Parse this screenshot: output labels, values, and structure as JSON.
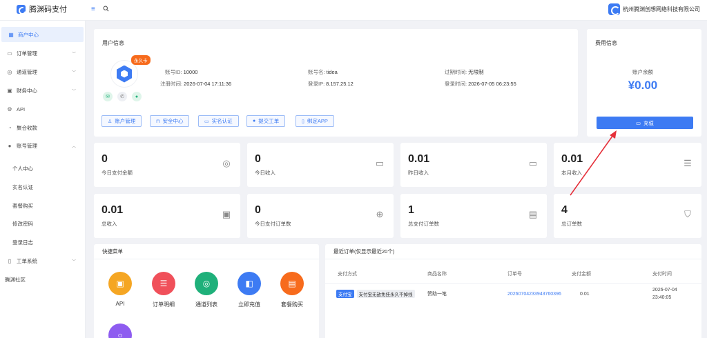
{
  "header": {
    "app_name": "腾渊码支付",
    "company_name": "杭州腾渊创想网络科技有限公司",
    "menu_icon": "menu-icon",
    "search_icon": "search-icon"
  },
  "sidebar": {
    "items": [
      {
        "label": "商户中心",
        "icon": "dashboard-icon",
        "active": true
      },
      {
        "label": "订单管理",
        "icon": "order-icon",
        "expandable": true
      },
      {
        "label": "通道管理",
        "icon": "channel-icon",
        "expandable": true
      },
      {
        "label": "财务中心",
        "icon": "finance-icon",
        "expandable": true
      },
      {
        "label": "API",
        "icon": "api-icon"
      },
      {
        "label": "聚合收款",
        "icon": "aggregate-icon"
      },
      {
        "label": "账号管理",
        "icon": "user-icon",
        "expandable": true,
        "expanded": true
      }
    ],
    "account_sub": [
      "个人中心",
      "实名认证",
      "套餐购买",
      "修改密码",
      "登录日志"
    ],
    "ticket": {
      "label": "工单系统",
      "icon": "ticket-icon"
    },
    "community": "腾渊社区"
  },
  "user_info": {
    "title": "用户信息",
    "badge": "永久卡",
    "account_id_label": "账号ID:",
    "account_id": "10000",
    "register_time_label": "注册时间:",
    "register_time": "2026-07-04 17:11:36",
    "account_name_label": "账号名:",
    "account_name": "tidea",
    "login_ip_label": "登录IP:",
    "login_ip": "8.157.25.12",
    "expire_label": "过期时间:",
    "expire": "无限制",
    "login_time_label": "登录时间:",
    "login_time": "2026-07-05 06:23:55",
    "buttons": [
      "账户管理",
      "安全中心",
      "实名认证",
      "提交工单",
      "绑定APP"
    ]
  },
  "fee_info": {
    "title": "费用信息",
    "balance_label": "账户余额",
    "balance": "¥0.00",
    "recharge_label": "充值"
  },
  "stats": [
    {
      "value": "0",
      "label": "今日支付金额",
      "icon": "gauge-icon"
    },
    {
      "value": "0",
      "label": "今日收入",
      "icon": "folder-icon"
    },
    {
      "value": "0.01",
      "label": "昨日收入",
      "icon": "folder-icon"
    },
    {
      "value": "0.01",
      "label": "本月收入",
      "icon": "database-icon"
    },
    {
      "value": "0.01",
      "label": "总收入",
      "icon": "money-icon"
    },
    {
      "value": "0",
      "label": "今日支付订单数",
      "icon": "target-icon"
    },
    {
      "value": "1",
      "label": "总支付订单数",
      "icon": "card-icon"
    },
    {
      "value": "4",
      "label": "总订单数",
      "icon": "cart-icon"
    }
  ],
  "quick_menu": {
    "title": "快捷菜单",
    "items": [
      {
        "label": "API",
        "color": "#f5a623",
        "icon": "chip-icon"
      },
      {
        "label": "订单明细",
        "color": "#f0505a",
        "icon": "database-icon"
      },
      {
        "label": "通道列表",
        "color": "#1fb07a",
        "icon": "channel-icon"
      },
      {
        "label": "立即充值",
        "color": "#3d7bf3",
        "icon": "wallet-icon"
      },
      {
        "label": "套餐购买",
        "color": "#f76b1c",
        "icon": "clipboard-icon"
      }
    ],
    "extra_item_color": "#8e5cf0"
  },
  "recent_orders": {
    "title": "最近订单(仅显示最近20个)",
    "columns": [
      "支付方式",
      "商品名称",
      "订单号",
      "支付金额",
      "支付时间"
    ],
    "rows": [
      {
        "pay_type": "支付宝",
        "pay_desc": "支付宝无敌免挂永久不掉线",
        "product": "赞助一笔",
        "order_no": "20260704233943760396",
        "amount": "0.01",
        "date": "2026-07-04",
        "time": "23:40:05"
      }
    ]
  },
  "colors": {
    "primary": "#3d7bf3",
    "badge": "#f76b1c",
    "arrow": "#e5303a"
  }
}
